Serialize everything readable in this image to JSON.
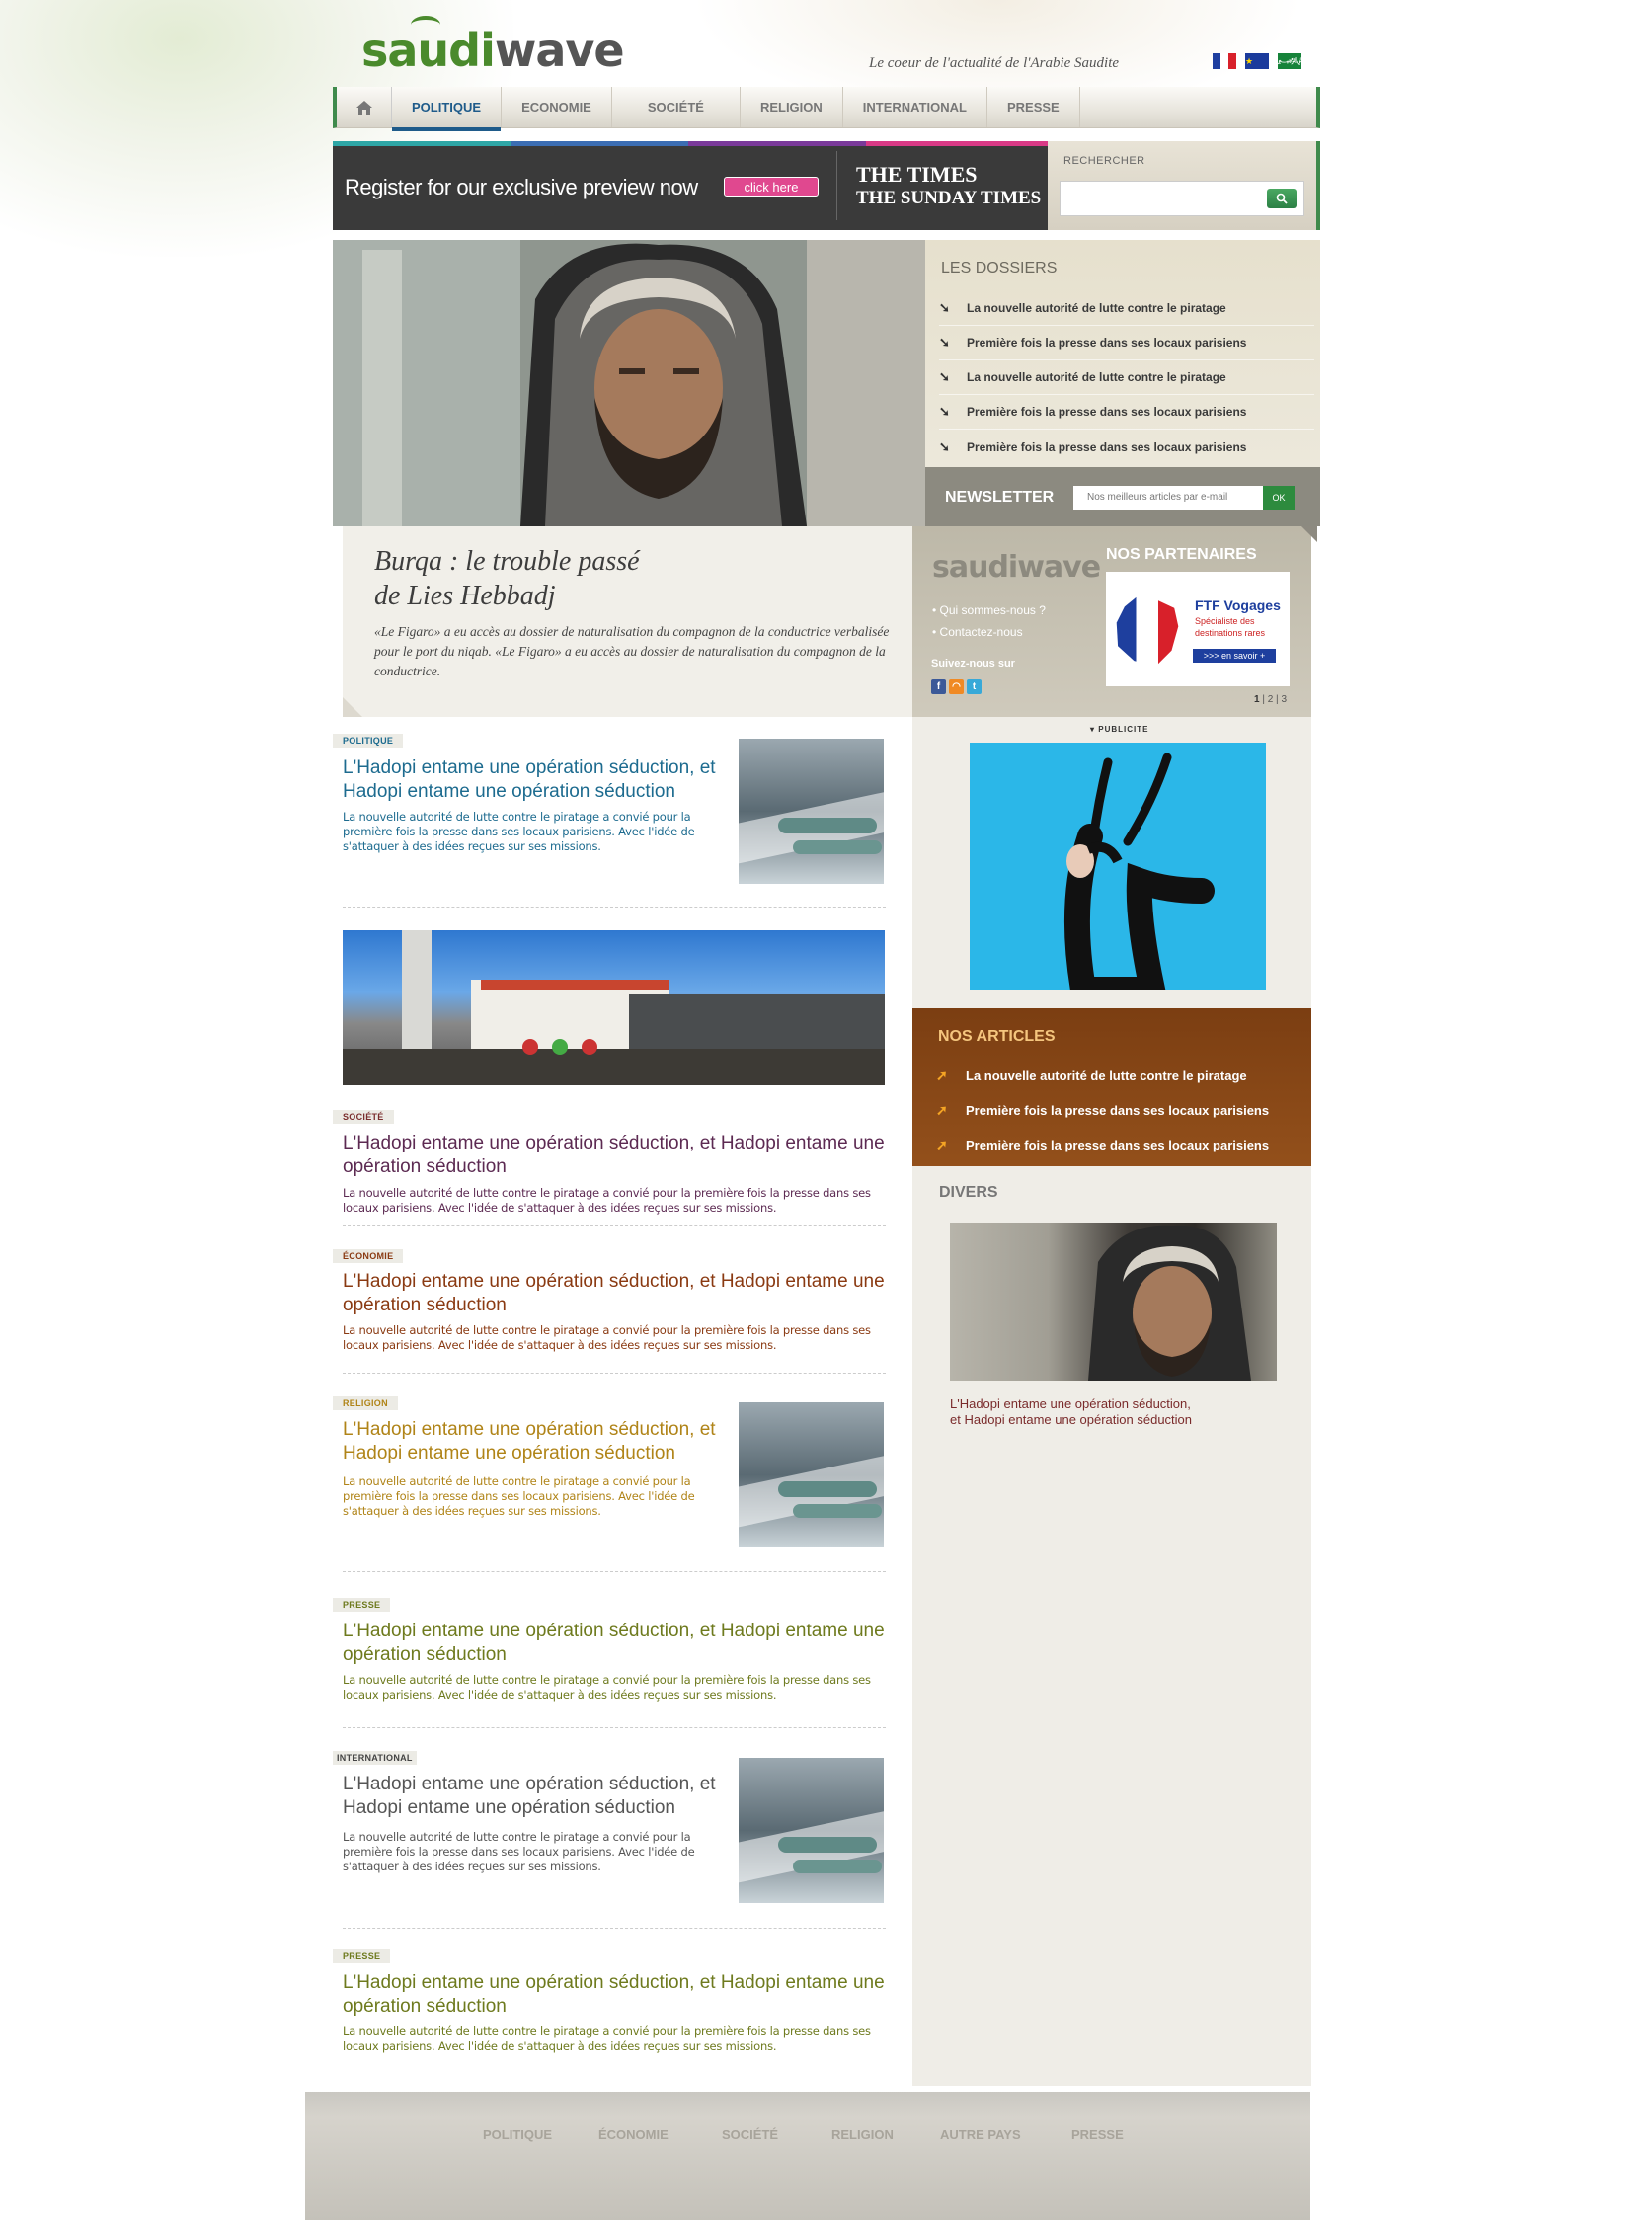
{
  "header": {
    "logo_a": "saudi",
    "logo_b": "wave",
    "tagline": "Le coeur de l'actualité de l'Arabie Saudite",
    "flags": [
      "fr-flag",
      "eu-flag",
      "sa-flag"
    ]
  },
  "nav": {
    "home_icon": "home-icon",
    "items": [
      "POLITIQUE",
      "ECONOMIE",
      "SOCIÉTÉ",
      "RELIGION",
      "INTERNATIONAL",
      "PRESSE"
    ],
    "active": "POLITIQUE"
  },
  "banner": {
    "text": "Register for our exclusive preview now",
    "button": "click here",
    "times_1": "THE TIMES",
    "times_2": "THE SUNDAY TIMES"
  },
  "search": {
    "label": "RECHERCHER",
    "placeholder": ""
  },
  "dossiers": {
    "title": "LES DOSSIERS",
    "items": [
      "La nouvelle autorité de lutte contre le piratage",
      "Première fois la presse dans ses locaux parisiens",
      "La nouvelle autorité de lutte contre le piratage",
      "Première fois la presse dans ses locaux parisiens",
      "Première fois la presse dans ses locaux parisiens"
    ]
  },
  "newsletter": {
    "label": "NEWSLETTER",
    "placeholder": "Nos meilleurs articles par e-mail",
    "button": "OK"
  },
  "feature": {
    "title_1": "Burqa : le trouble passé",
    "title_2": "de Lies Hebbadj",
    "desc": "«Le Figaro» a eu accès au dossier de naturalisation du compagnon de la conductrice verbalisée pour le port du niqab. «Le Figaro» a eu accès au dossier de naturalisation du compagnon de la conductrice."
  },
  "about": {
    "logo": "saudiwave",
    "links": [
      "• Qui sommes-nous ?",
      "• Contactez-nous"
    ],
    "follow": "Suivez-nous sur",
    "social_icons": [
      "facebook-icon",
      "rss-icon",
      "twitter-icon"
    ]
  },
  "partners": {
    "title": "NOS PARTENAIRES",
    "name": "FTF Vogages",
    "sub": "Spécialiste des destinations rares",
    "more": ">>> en savoir +",
    "pager": [
      "1",
      "2",
      "3"
    ]
  },
  "pub": {
    "label": "▾ PUBLICITE"
  },
  "nos_articles": {
    "title": "NOS ARTICLES",
    "items": [
      "La nouvelle autorité de lutte contre le piratage",
      "Première fois la presse dans ses locaux parisiens",
      "Première fois la presse dans ses locaux parisiens"
    ]
  },
  "divers": {
    "title": "DIVERS",
    "caption_1": "L'Hadopi entame une opération séduction,",
    "caption_2": "et Hadopi entame une opération séduction"
  },
  "articles": [
    {
      "tag": "POLITIQUE",
      "title": "L'Hadopi entame une opération séduction, et Hadopi entame une opération séduction",
      "desc": "La nouvelle autorité de lutte contre le piratage a convié pour la première fois la presse dans ses locaux parisiens. Avec l'idée de s'attaquer à des idées reçues sur ses missions.",
      "color": "#1d6b8f",
      "tag_color": "#1d6b8f"
    },
    {
      "tag": "SOCIÉTÉ",
      "title": "L'Hadopi entame une opération séduction, et Hadopi entame une opération séduction",
      "desc": "La nouvelle autorité de lutte contre le piratage a convié pour la première fois la presse dans ses locaux parisiens. Avec l'idée de s'attaquer à des idées reçues sur ses missions.",
      "color": "#5c2a52",
      "tag_color": "#7a2d2d"
    },
    {
      "tag": "ÉCONOMIE",
      "title": "L'Hadopi entame une opération séduction, et Hadopi entame une opération séduction",
      "desc": "La nouvelle autorité de lutte contre le piratage a convié pour la première fois la presse dans ses locaux parisiens. Avec l'idée de s'attaquer à des idées reçues sur ses missions.",
      "color": "#8a3a12",
      "tag_color": "#8a3a12"
    },
    {
      "tag": "RELIGION",
      "title": "L'Hadopi entame une opération séduction, et Hadopi entame une opération séduction",
      "desc": "La nouvelle autorité de lutte contre le piratage a convié pour la première fois la presse dans ses locaux parisiens. Avec l'idée de s'attaquer à des idées reçues sur ses missions.",
      "color": "#b08418",
      "tag_color": "#b08418"
    },
    {
      "tag": "PRESSE",
      "title": "L'Hadopi entame une opération séduction, et Hadopi entame une opération séduction",
      "desc": "La nouvelle autorité de lutte contre le piratage a convié pour la première fois la presse dans ses locaux parisiens. Avec l'idée de s'attaquer à des idées reçues sur ses missions.",
      "color": "#6e7a1e",
      "tag_color": "#6e7a1e"
    },
    {
      "tag": "INTERNATIONAL",
      "title": "L'Hadopi entame une opération séduction, et Hadopi entame une opération séduction",
      "desc": "La nouvelle autorité de lutte contre le piratage a convié pour la première fois la presse dans ses locaux parisiens. Avec l'idée de s'attaquer à des idées reçues sur ses missions.",
      "color": "#555555",
      "tag_color": "#444444"
    },
    {
      "tag": "PRESSE",
      "title": "L'Hadopi entame une opération séduction, et Hadopi entame une opération séduction",
      "desc": "La nouvelle autorité de lutte contre le piratage a convié pour la première fois la presse dans ses locaux parisiens. Avec l'idée de s'attaquer à des idées reçues sur ses missions.",
      "color": "#6e7a1e",
      "tag_color": "#6e7a1e"
    }
  ],
  "footer": {
    "items": [
      "POLITIQUE",
      "ÉCONOMIE",
      "SOCIÉTÉ",
      "RELIGION",
      "AUTRE PAYS",
      "PRESSE"
    ]
  },
  "colors": {
    "brand_green": "#4a8a2c",
    "nav_active": "#1f5b8a",
    "nos_articles_bg": "#8a4818"
  }
}
